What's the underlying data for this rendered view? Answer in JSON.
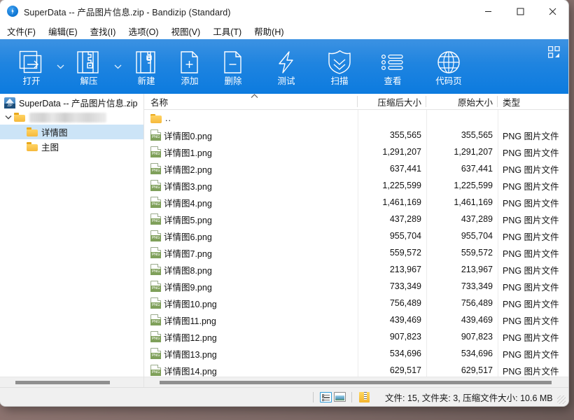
{
  "window": {
    "title": "SuperData -- 产品图片信息.zip - Bandizip (Standard)",
    "app_icon": "bandizip-bolt-icon",
    "controls": {
      "minimize": "minimize-icon",
      "maximize": "maximize-icon",
      "close": "close-icon"
    }
  },
  "menu": [
    {
      "label": "文件(F)",
      "name": "menu-file"
    },
    {
      "label": "编辑(E)",
      "name": "menu-edit"
    },
    {
      "label": "查找(I)",
      "name": "menu-find"
    },
    {
      "label": "选项(O)",
      "name": "menu-options"
    },
    {
      "label": "视图(V)",
      "name": "menu-view"
    },
    {
      "label": "工具(T)",
      "name": "menu-tools"
    },
    {
      "label": "帮助(H)",
      "name": "menu-help"
    }
  ],
  "toolbar": {
    "items": [
      {
        "label": "打开",
        "icon": "open-archive-icon",
        "caret": true
      },
      {
        "label": "解压",
        "icon": "extract-icon",
        "caret": true
      },
      {
        "label": "新建",
        "icon": "new-archive-icon",
        "caret": false
      },
      {
        "label": "添加",
        "icon": "add-file-icon",
        "caret": false
      },
      {
        "label": "删除",
        "icon": "delete-file-icon",
        "caret": false
      },
      {
        "label": "测试",
        "icon": "test-bolt-icon",
        "caret": false
      },
      {
        "label": "扫描",
        "icon": "scan-shield-icon",
        "caret": false
      },
      {
        "label": "查看",
        "icon": "view-list-icon",
        "caret": false
      },
      {
        "label": "代码页",
        "icon": "codepage-globe-icon",
        "caret": false
      }
    ],
    "expand_icon": "expand-grid-icon"
  },
  "tree": {
    "root": {
      "label": "SuperData -- 产品图片信息.zip",
      "icon": "zip-archive-icon"
    },
    "items": [
      {
        "label": "",
        "icon": "folder-icon",
        "redacted": true,
        "expanded": true,
        "selected": false,
        "depth": 1
      },
      {
        "label": "详情图",
        "icon": "folder-icon",
        "redacted": false,
        "expanded": false,
        "selected": true,
        "depth": 2
      },
      {
        "label": "主图",
        "icon": "folder-icon",
        "redacted": false,
        "expanded": false,
        "selected": false,
        "depth": 2
      }
    ]
  },
  "filelist": {
    "columns": [
      {
        "key": "name",
        "label": "名称",
        "sorted": "asc",
        "sort_icon": "sort-ascending-icon"
      },
      {
        "key": "compressed",
        "label": "压缩后大小"
      },
      {
        "key": "original",
        "label": "原始大小"
      },
      {
        "key": "type",
        "label": "类型"
      }
    ],
    "parent_row": {
      "name": "..",
      "icon": "folder-icon"
    },
    "rows": [
      {
        "name": "详情图0.png",
        "compressed": "355,565",
        "original": "355,565",
        "type": "PNG 图片文件",
        "icon": "png-file-icon"
      },
      {
        "name": "详情图1.png",
        "compressed": "1,291,207",
        "original": "1,291,207",
        "type": "PNG 图片文件",
        "icon": "png-file-icon"
      },
      {
        "name": "详情图2.png",
        "compressed": "637,441",
        "original": "637,441",
        "type": "PNG 图片文件",
        "icon": "png-file-icon"
      },
      {
        "name": "详情图3.png",
        "compressed": "1,225,599",
        "original": "1,225,599",
        "type": "PNG 图片文件",
        "icon": "png-file-icon"
      },
      {
        "name": "详情图4.png",
        "compressed": "1,461,169",
        "original": "1,461,169",
        "type": "PNG 图片文件",
        "icon": "png-file-icon"
      },
      {
        "name": "详情图5.png",
        "compressed": "437,289",
        "original": "437,289",
        "type": "PNG 图片文件",
        "icon": "png-file-icon"
      },
      {
        "name": "详情图6.png",
        "compressed": "955,704",
        "original": "955,704",
        "type": "PNG 图片文件",
        "icon": "png-file-icon"
      },
      {
        "name": "详情图7.png",
        "compressed": "559,572",
        "original": "559,572",
        "type": "PNG 图片文件",
        "icon": "png-file-icon"
      },
      {
        "name": "详情图8.png",
        "compressed": "213,967",
        "original": "213,967",
        "type": "PNG 图片文件",
        "icon": "png-file-icon"
      },
      {
        "name": "详情图9.png",
        "compressed": "733,349",
        "original": "733,349",
        "type": "PNG 图片文件",
        "icon": "png-file-icon"
      },
      {
        "name": "详情图10.png",
        "compressed": "756,489",
        "original": "756,489",
        "type": "PNG 图片文件",
        "icon": "png-file-icon"
      },
      {
        "name": "详情图11.png",
        "compressed": "439,469",
        "original": "439,469",
        "type": "PNG 图片文件",
        "icon": "png-file-icon"
      },
      {
        "name": "详情图12.png",
        "compressed": "907,823",
        "original": "907,823",
        "type": "PNG 图片文件",
        "icon": "png-file-icon"
      },
      {
        "name": "详情图13.png",
        "compressed": "534,696",
        "original": "534,696",
        "type": "PNG 图片文件",
        "icon": "png-file-icon"
      },
      {
        "name": "详情图14.png",
        "compressed": "629,517",
        "original": "629,517",
        "type": "PNG 图片文件",
        "icon": "png-file-icon"
      }
    ]
  },
  "statusbar": {
    "icons": [
      {
        "name": "list-view-icon",
        "active": true
      },
      {
        "name": "thumbnail-view-icon",
        "active": false
      },
      {
        "name": "archive-folder-icon",
        "active": false
      }
    ],
    "text": "文件: 15, 文件夹: 3, 压缩文件大小: 10.6 MB",
    "resize_grip": "resize-grip-icon"
  },
  "colors": {
    "toolbar_top": "#3c92e2",
    "toolbar_bottom": "#0c7bdf",
    "selection": "#cce4f7",
    "accent": "#0a72d0"
  }
}
